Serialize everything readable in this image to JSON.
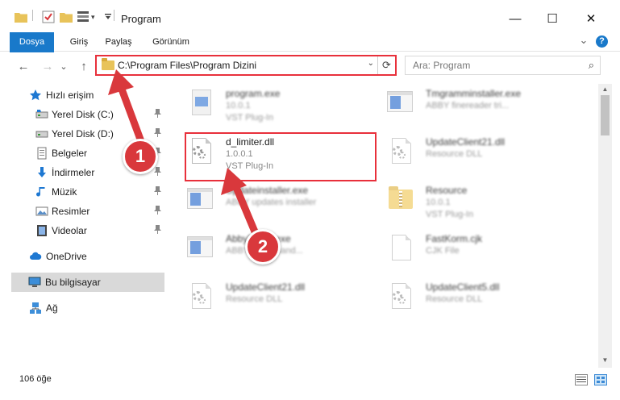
{
  "window": {
    "title": "Program",
    "minimize_glyph": "—",
    "maximize_glyph": "☐",
    "close_glyph": "✕"
  },
  "ribbon": {
    "tabs": [
      "Dosya",
      "Giriş",
      "Paylaş",
      "Görünüm"
    ],
    "expand_glyph": "⌄",
    "help_glyph": "?"
  },
  "nav": {
    "back_glyph": "←",
    "forward_glyph": "→",
    "recent_glyph": "⌄",
    "up_glyph": "↑"
  },
  "address": {
    "path": "C:\\Program Files\\Program Dizini",
    "dropdown_glyph": "⌄",
    "refresh_glyph": "⟳"
  },
  "search": {
    "placeholder": "Ara: Program",
    "icon_glyph": "⌕"
  },
  "sidebar": {
    "pin_glyph": "📌",
    "items": [
      {
        "label": "Hızlı erişim",
        "icon": "star-icon"
      },
      {
        "label": "Yerel Disk (C:)",
        "icon": "drive-icon"
      },
      {
        "label": "Yerel Disk (D:)",
        "icon": "drive-icon"
      },
      {
        "label": "Belgeler",
        "icon": "documents-icon"
      },
      {
        "label": "İndirmeler",
        "icon": "download-icon"
      },
      {
        "label": "Müzik",
        "icon": "music-icon"
      },
      {
        "label": "Resimler",
        "icon": "pictures-icon"
      },
      {
        "label": "Videolar",
        "icon": "videos-icon"
      },
      {
        "label": "OneDrive",
        "icon": "cloud-icon"
      },
      {
        "label": "Bu bilgisayar",
        "icon": "computer-icon"
      },
      {
        "label": "Ağ",
        "icon": "network-icon"
      }
    ]
  },
  "files": [
    {
      "name": "program.exe",
      "meta1": "10.0.1",
      "meta2": "VST Plug-In",
      "icon": "exe-icon"
    },
    {
      "name": "Tmgramminstaller.exe",
      "meta1": "ABBY finereader tri...",
      "meta2": "",
      "icon": "app-window-icon"
    },
    {
      "name": "d_limiter.dll",
      "meta1": "1.0.0.1",
      "meta2": "VST Plug-In",
      "icon": "dll-gear-icon"
    },
    {
      "name": "UpdateClient21.dll",
      "meta1": "Resource DLL",
      "meta2": "",
      "icon": "dll-gear-icon"
    },
    {
      "name": "Updateinstaller.exe",
      "meta1": "ABBY updates installer",
      "meta2": "",
      "icon": "app-window-icon"
    },
    {
      "name": "Resource",
      "meta1": "10.0.1",
      "meta2": "VST Plug-In",
      "icon": "zip-folder-icon"
    },
    {
      "name": "AbbyEvent.exe",
      "meta1": "ABBY event hand...",
      "meta2": "",
      "icon": "app-window-icon"
    },
    {
      "name": "FastKorm.cjk",
      "meta1": "CJK File",
      "meta2": "",
      "icon": "blank-file-icon"
    },
    {
      "name": "UpdateClient21.dll",
      "meta1": "Resource DLL",
      "meta2": "",
      "icon": "dll-gear-icon"
    },
    {
      "name": "UpdateClient5.dll",
      "meta1": "Resource DLL",
      "meta2": "",
      "icon": "dll-gear-icon"
    }
  ],
  "status": {
    "count": "106 öğe"
  },
  "callouts": [
    "1",
    "2"
  ],
  "colors": {
    "accent": "#1979ca",
    "highlight": "#e8303b",
    "callout": "#d9383c",
    "selected": "#d9d9d9"
  }
}
